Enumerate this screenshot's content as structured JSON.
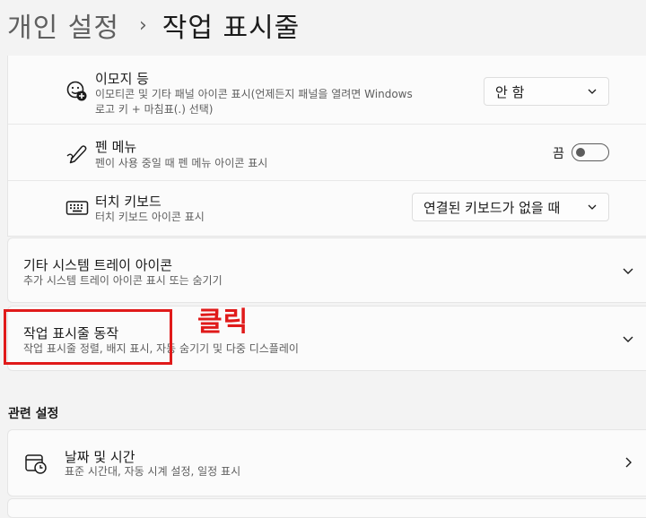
{
  "breadcrumb": {
    "parent": "개인 설정",
    "separator": "›",
    "current": "작업 표시줄"
  },
  "tray_icons": {
    "emoji": {
      "icon": "emoji-add-icon",
      "title": "이모지 등",
      "description_line1": "이모티콘 및 기타 패널 아이콘 표시(언제든지 패널을 열려면 Windows",
      "description_line2": "로고 키 + 마침표(.) 선택)",
      "dropdown_value": "안 함"
    },
    "pen_menu": {
      "icon": "pen-icon",
      "title": "펜 메뉴",
      "description": "펜이 사용 중일 때 펜 메뉴 아이콘 표시",
      "toggle_label": "끔",
      "toggle_on": false
    },
    "touch_keyboard": {
      "icon": "keyboard-icon",
      "title": "터치 키보드",
      "description": "터치 키보드 아이콘 표시",
      "dropdown_value": "연결된 키보드가 없을 때"
    }
  },
  "other_tray": {
    "title": "기타 시스템 트레이 아이콘",
    "description": "추가 시스템 트레이 아이콘 표시 또는 숨기기"
  },
  "taskbar_behaviors": {
    "title": "작업 표시줄 동작",
    "description": "작업 표시줄 정렬, 배지 표시, 자동 숨기기 및 다중 디스플레이"
  },
  "annotation": {
    "label": "클릭",
    "color": "#e01a1a"
  },
  "related_settings": {
    "heading": "관련 설정",
    "date_time": {
      "icon": "calendar-clock-icon",
      "title": "날짜 및 시간",
      "description": "표준 시간대, 자동 시계 설정, 일정 표시"
    }
  },
  "colors": {
    "background": "#f3f3f3",
    "card": "#fbfbfb"
  }
}
